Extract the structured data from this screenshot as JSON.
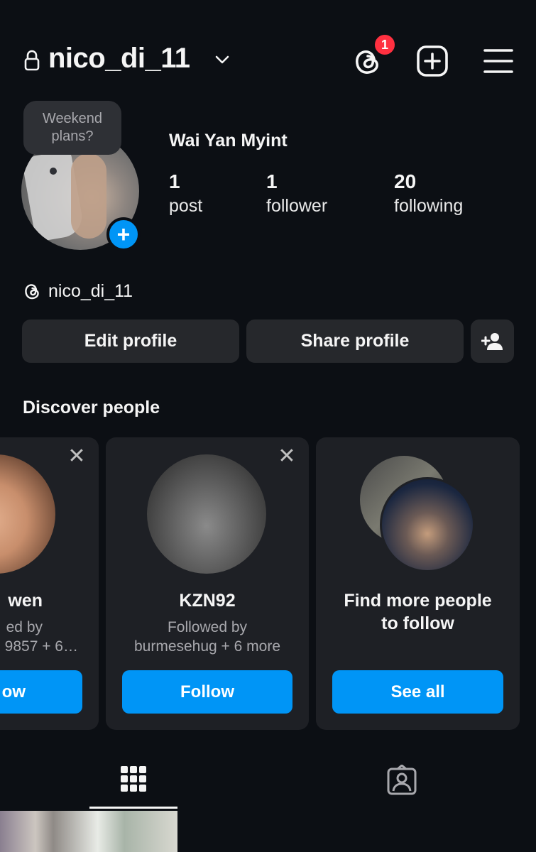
{
  "header": {
    "username": "nico_di_11",
    "notification_count": "1",
    "icons": [
      "lock-icon",
      "chevron-down-icon",
      "threads-icon",
      "new-post-icon",
      "menu-icon"
    ]
  },
  "profile": {
    "note": {
      "line1": "Weekend",
      "line2": "plans?"
    },
    "full_name": "Wai Yan Myint",
    "stats": {
      "posts": {
        "value": "1",
        "label": "post"
      },
      "followers": {
        "value": "1",
        "label": "follower"
      },
      "following": {
        "value": "20",
        "label": "following"
      }
    },
    "threads_handle": "nico_di_11"
  },
  "actions": {
    "edit_profile": "Edit profile",
    "share_profile": "Share profile"
  },
  "discover": {
    "title": "Discover people",
    "cards": [
      {
        "name": "wen",
        "sub1": "ed by",
        "sub2": "9857 + 6…",
        "button": "ow"
      },
      {
        "name": "KZN92",
        "sub1": "Followed by",
        "sub2": "burmesehug + 6 more",
        "button": "Follow"
      },
      {
        "name_line1": "Find more people",
        "name_line2": "to follow",
        "button": "See all"
      }
    ]
  },
  "tabs": [
    "grid-icon",
    "tagged-icon"
  ],
  "colors": {
    "background": "#0c0f14",
    "accent": "#0095f6",
    "badge": "#ff3040",
    "button_bg": "#26282c",
    "card_bg": "#1e2025"
  }
}
